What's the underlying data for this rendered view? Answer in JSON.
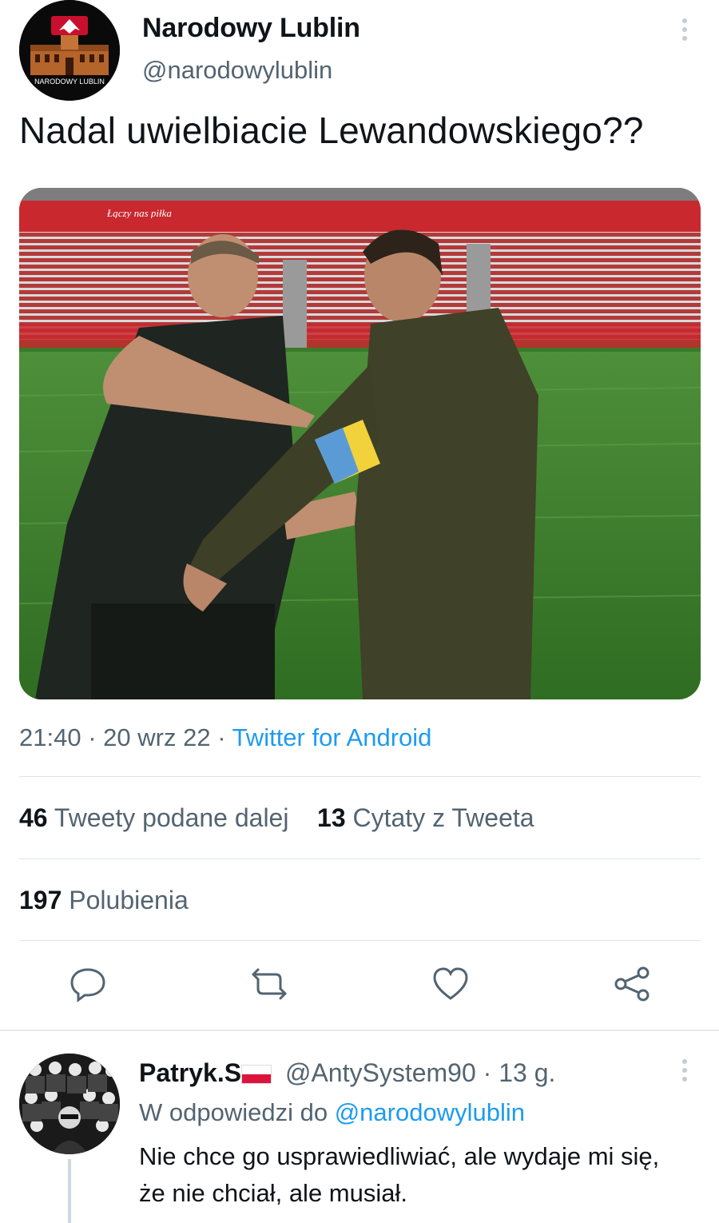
{
  "tweet": {
    "author_name": "Narodowy Lublin",
    "author_handle": "@narodowylublin",
    "avatar_label": "NARODOWY LUBLIN",
    "text": "Nadal uwielbiacie Lewandowskiego??",
    "photo": {
      "banner_text": "Łączy nas piłka"
    },
    "time": "21:40",
    "date": "20 wrz 22",
    "separator": "·",
    "source": "Twitter for Android",
    "retweets_count": "46",
    "retweets_label": "Tweety podane dalej",
    "quotes_count": "13",
    "quotes_label": "Cytaty z Tweeta",
    "likes_count": "197",
    "likes_label": "Polubienia"
  },
  "actions": {
    "reply_icon": "reply-icon",
    "retweet_icon": "retweet-icon",
    "like_icon": "heart-icon",
    "share_icon": "share-icon"
  },
  "reply": {
    "author_name": "Patryk.S",
    "flag": "poland-flag",
    "author_handle": "@AntySystem90",
    "separator": "·",
    "time_ago": "13 g.",
    "replying_to_prefix": "W odpowiedzi do",
    "replying_to_handle": "@narodowylublin",
    "text": "Nie chce go usprawiedliwiać, ale wydaje mi się, że nie chciał, ale musiał."
  },
  "colors": {
    "accent": "#1d9bf0",
    "text_primary": "#0f1419",
    "text_secondary": "#536471",
    "divider": "#dfe3e6"
  }
}
